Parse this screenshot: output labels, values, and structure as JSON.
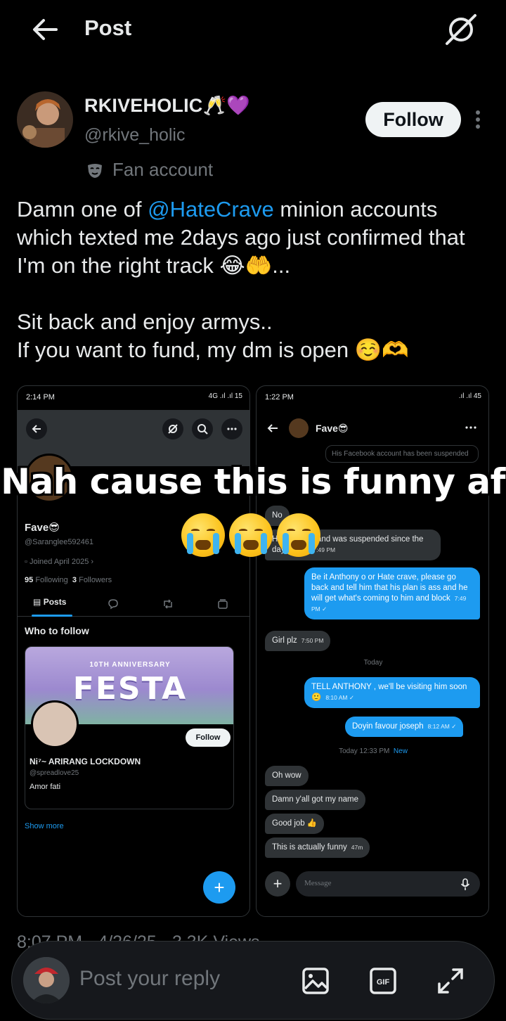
{
  "header": {
    "title": "Post"
  },
  "author": {
    "display_name": "RKIVEHOLIC🥂💜",
    "handle": "@rkive_holic",
    "label": "Fan account",
    "follow_label": "Follow"
  },
  "tweet": {
    "text_1": "Damn one of ",
    "mention": "@HateCrave",
    "text_2": " minion accounts which texted me 2days ago just confirmed that I'm on the right track 😂🤲...\n\nSit back and enjoy armys..\nIf you want to fund, my dm is open ☺️🫶"
  },
  "media": {
    "left": {
      "status_time": "2:14 PM",
      "status_right": "4G .ıl .ıl 15",
      "profile_name": "Fave😎",
      "profile_handle": "@Saranglee592461",
      "joined": "Joined April 2025 ›",
      "following_count": "95",
      "following_label": "Following",
      "followers_count": "3",
      "followers_label": "Followers",
      "tab_posts": "Posts",
      "who_to_follow": "Who to follow",
      "banner_top": "10TH ANNIVERSARY",
      "banner_main": "FESTA",
      "card_follow": "Follow",
      "card_name": "Ni⁷~ ARIRANG LOCKDOWN",
      "card_handle": "@spreadlove25",
      "card_bio": "Amor fati",
      "show_more": "Show more",
      "fab": "+"
    },
    "right": {
      "status_time": "1:22 PM",
      "status_right": ".ıl .ıl 45",
      "chat_name": "Fave😎",
      "system_msg": "His Facebook account has been suspended",
      "msg_no": "No",
      "msg_reported": "He reported and was suspended since the day I think",
      "msg_reported_time": "7:49 PM",
      "msg_anthony": "Be it Anthony o or Hate crave, please go back and tell him that his plan is ass and he will get what's coming to him and block",
      "msg_anthony_time": "7:49 PM ✓",
      "msg_girl": "Girl plz",
      "msg_girl_time": "7:50 PM",
      "day_today": "Today",
      "msg_tell": "TELL ANTHONY , we'll be visiting him soon 🙂",
      "msg_tell_time": "8:10 AM ✓",
      "msg_doyin": "Doyin favour joseph",
      "msg_doyin_time": "8:12 AM ✓",
      "today_time": "Today 12:33 PM",
      "new_label": "New",
      "msg_oh": "Oh wow",
      "msg_damn": "Damn y'all got my name",
      "msg_good": "Good job 👍",
      "msg_funny": "This is actually funny",
      "msg_funny_time": "47m",
      "input_placeholder": "Message",
      "plus": "+"
    },
    "overlay_caption": "Nah cause this is funny af"
  },
  "meta": {
    "text": "8:07 PM · 4/26/25 · 3.3K Views"
  },
  "reply": {
    "placeholder": "Post your reply",
    "icons": [
      "image-icon",
      "gif-icon",
      "expand-icon"
    ]
  },
  "colors": {
    "accent": "#1d9bf0",
    "background": "#000000",
    "muted": "#71767b"
  }
}
